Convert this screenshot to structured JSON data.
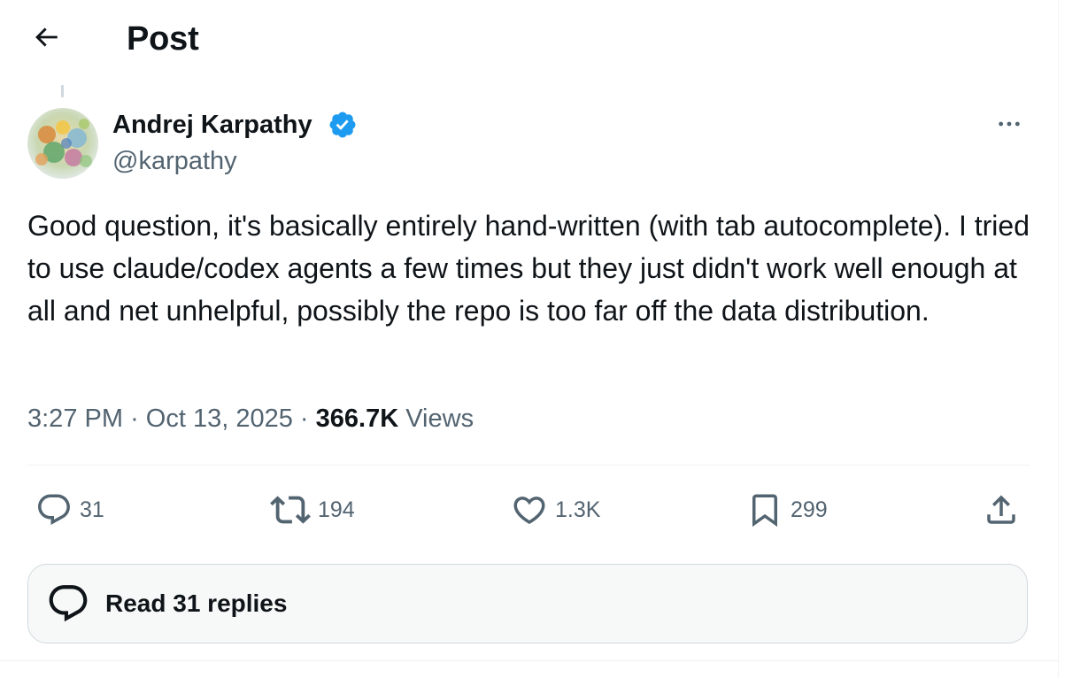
{
  "header": {
    "title": "Post",
    "back_icon": "arrow-left-icon"
  },
  "post": {
    "author": {
      "name": "Andrej Karpathy",
      "handle": "@karpathy",
      "verified": true,
      "verified_color": "#1d9bf0",
      "avatar_icon": "profile-avatar"
    },
    "more_icon": "more-horizontal-icon",
    "text": "Good question, it's basically entirely hand-written (with tab autocomplete). I tried to use claude/codex agents a few times but they just didn't work well enough at all and net unhelpful, possibly the repo is too far off the data distribution.",
    "time": "3:27 PM",
    "separator": "·",
    "date": "Oct 13, 2025",
    "views_count": "366.7K",
    "views_label": "Views"
  },
  "actions": {
    "replies": {
      "count": "31",
      "icon": "reply-bubble-icon"
    },
    "reposts": {
      "count": "194",
      "icon": "repost-icon"
    },
    "likes": {
      "count": "1.3K",
      "icon": "heart-icon"
    },
    "bookmarks": {
      "count": "299",
      "icon": "bookmark-icon"
    },
    "share": {
      "icon": "share-upload-icon"
    }
  },
  "read_replies": {
    "label": "Read 31 replies",
    "icon": "chat-bubbles-icon"
  },
  "colors": {
    "text_primary": "#0f1419",
    "text_secondary": "#536471",
    "accent_blue": "#1d9bf0",
    "border": "#cfd9de",
    "divider": "#eff3f4",
    "button_bg": "#f7f9f9"
  }
}
